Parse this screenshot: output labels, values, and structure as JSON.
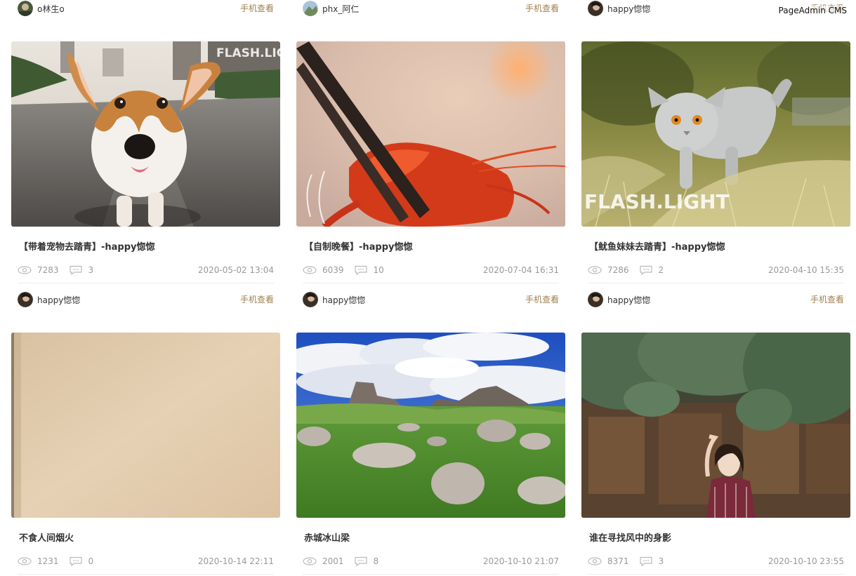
{
  "watermark": "PageAdmin CMS",
  "mobile_link_label": "手机查看",
  "top_row": [
    {
      "author": "o林生o"
    },
    {
      "author": "phx_阿仁"
    },
    {
      "author": "happy惚惚"
    }
  ],
  "cards": [
    {
      "title": "【带着宠物去踏青】-happy惚惚",
      "views": "7283",
      "comments": "3",
      "date": "2020-05-02  13:04",
      "author": "happy惚惚",
      "image": "corgi-photo"
    },
    {
      "title": "【自制晚餐】-happy惚惚",
      "views": "6039",
      "comments": "10",
      "date": "2020-07-04  16:31",
      "author": "happy惚惚",
      "image": "crayfish-photo"
    },
    {
      "title": "【鱿鱼妹妹去踏青】-happy惚惚",
      "views": "7286",
      "comments": "2",
      "date": "2020-04-10  15:35",
      "author": "happy惚惚",
      "image": "cat-photo"
    },
    {
      "title": "不食人间烟火",
      "views": "1231",
      "comments": "0",
      "date": "2020-10-14  22:11",
      "image": "beige-photo"
    },
    {
      "title": "赤城冰山梁",
      "views": "2001",
      "comments": "8",
      "date": "2020-10-10  21:07",
      "image": "landscape-photo"
    },
    {
      "title": "谁在寻找风中的身影",
      "views": "8371",
      "comments": "3",
      "date": "2020-10-10  23:55",
      "image": "woman-photo"
    }
  ],
  "image_text": {
    "flash_light": "FLASH.LIGHT"
  }
}
